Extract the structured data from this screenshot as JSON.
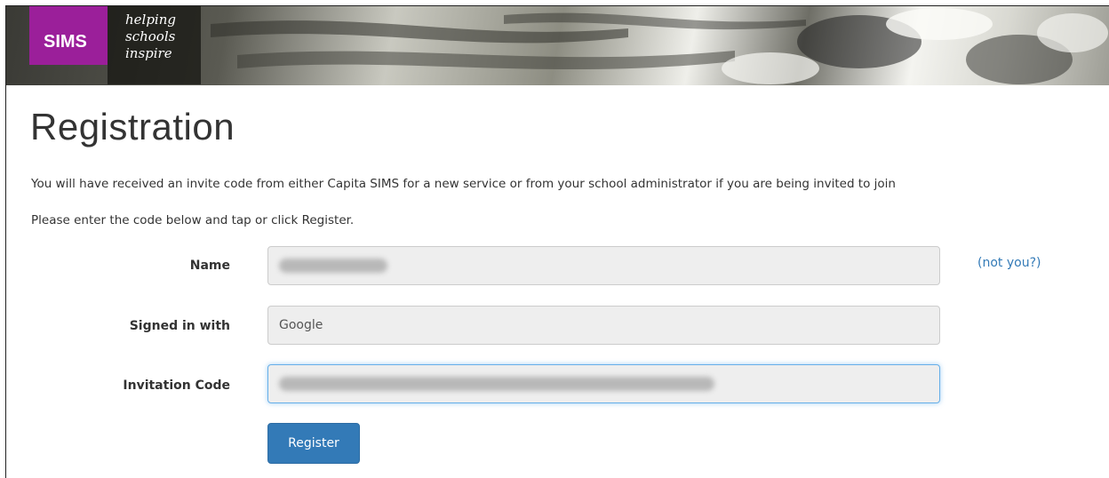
{
  "brand": {
    "logo_text": "SIMS",
    "tagline": [
      "helping",
      "schools",
      "inspire"
    ],
    "logo_color": "#9b1f9a"
  },
  "page": {
    "title": "Registration",
    "intro_line1": "You will have received an invite code from either Capita SIMS for a new service or from your school administrator if you are being invited to join",
    "intro_line2": "Please enter the code below and tap or click Register."
  },
  "form": {
    "name_label": "Name",
    "name_value": "",
    "not_you_link": "(not you?)",
    "signed_in_label": "Signed in with",
    "signed_in_value": "Google",
    "invitation_label": "Invitation Code",
    "invitation_value": "",
    "register_button": "Register"
  },
  "colors": {
    "link": "#337ab7",
    "primary_button": "#337ab7",
    "focus_border": "#66afe9"
  }
}
